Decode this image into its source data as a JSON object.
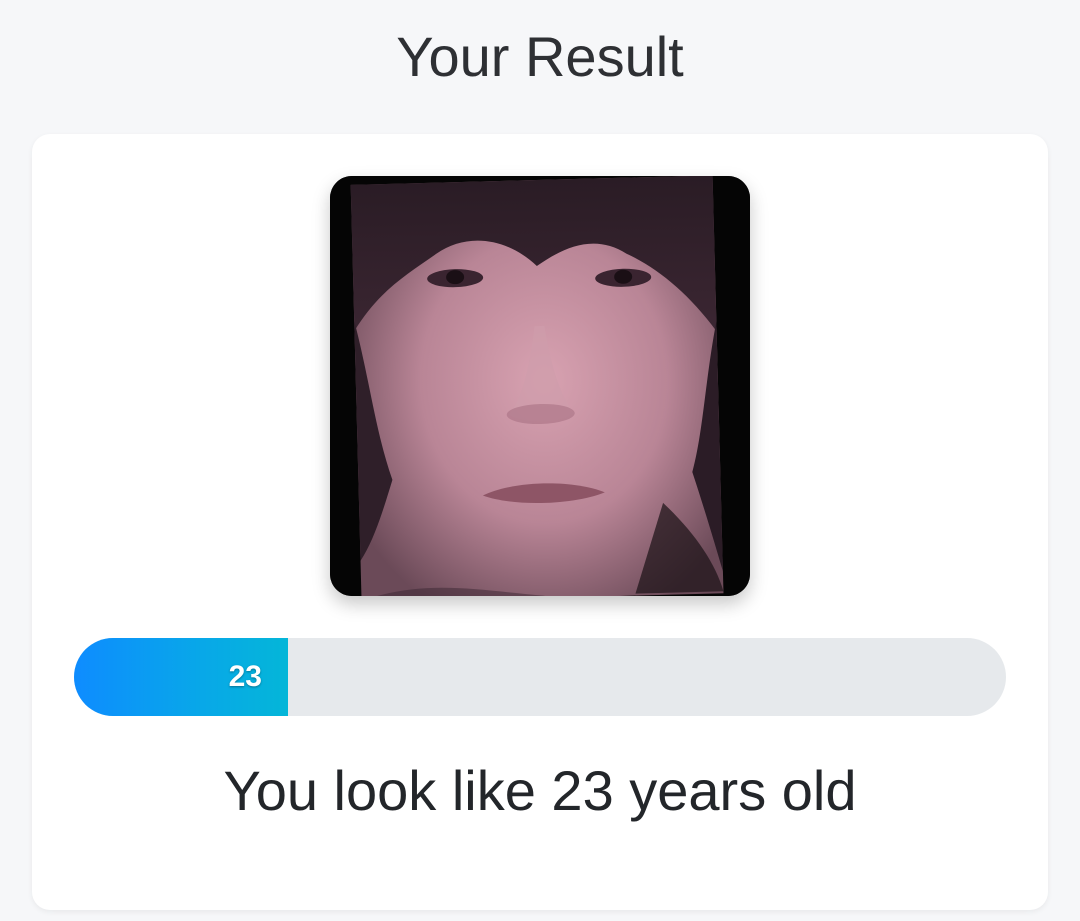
{
  "header": {
    "title": "Your Result"
  },
  "result": {
    "photo": "face-photo",
    "estimated_age": "23",
    "progress_fraction": 0.23,
    "message": "You look like 23 years old"
  },
  "colors": {
    "background": "#f6f7f9",
    "card": "#ffffff",
    "progress_track": "#e6e9ec",
    "progress_fill_start": "#0e8cff",
    "progress_fill_end": "#04b6d8",
    "text": "#23262a"
  }
}
